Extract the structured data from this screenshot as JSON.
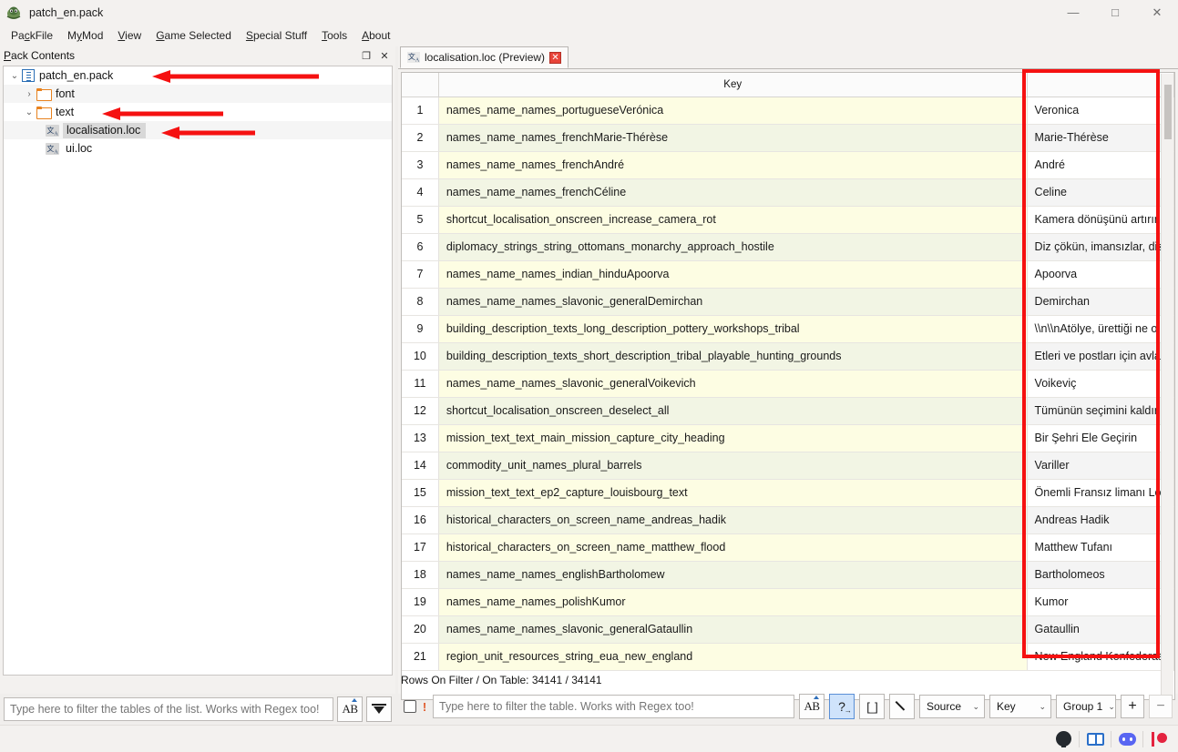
{
  "window": {
    "title": "patch_en.pack",
    "app_icon": "rpfm-app-icon",
    "minimize_label": "—",
    "maximize_label": "□",
    "close_label": "✕"
  },
  "menubar": {
    "items": [
      {
        "label": "PackFile",
        "mnemonic_index": 3
      },
      {
        "label": "MyMod",
        "mnemonic_index": 1
      },
      {
        "label": "View",
        "mnemonic_index": 0
      },
      {
        "label": "Game Selected",
        "mnemonic_index": 0
      },
      {
        "label": "Special Stuff",
        "mnemonic_index": 0
      },
      {
        "label": "Tools",
        "mnemonic_index": 0
      },
      {
        "label": "About",
        "mnemonic_index": 0
      }
    ]
  },
  "left_panel": {
    "header_title": "Pack Contents",
    "float_button": "❐",
    "close_button": "✕",
    "tree": [
      {
        "label": "patch_en.pack",
        "icon": "pack-icon",
        "twisty": "⌄",
        "indent": 0,
        "selected": false
      },
      {
        "label": "font",
        "icon": "folder-icon",
        "twisty": "›",
        "indent": 1,
        "selected": false
      },
      {
        "label": "text",
        "icon": "folder-icon",
        "twisty": "⌄",
        "indent": 1,
        "selected": false
      },
      {
        "label": "localisation.loc",
        "icon": "loc-file-icon",
        "twisty": "",
        "indent": 2,
        "selected": true
      },
      {
        "label": "ui.loc",
        "icon": "loc-file-icon",
        "twisty": "",
        "indent": 2,
        "selected": false
      }
    ],
    "filter": {
      "placeholder": "Type here to filter the tables of the list. Works with Regex too!",
      "value": "",
      "case_button_icon": "case-sensitive-icon",
      "expand_button_icon": "collapse-all-icon"
    }
  },
  "main": {
    "tab": {
      "icon": "loc-file-icon",
      "label": "localisation.loc (Preview)",
      "close_label": "✕"
    },
    "table": {
      "columns": [
        "",
        "Key",
        ""
      ],
      "rows": [
        {
          "n": "1",
          "key": "names_name_names_portugueseVerónica",
          "value": "Veronica"
        },
        {
          "n": "2",
          "key": "names_name_names_frenchMarie-Thérèse",
          "value": "Marie-Thérèse"
        },
        {
          "n": "3",
          "key": "names_name_names_frenchAndré",
          "value": "André"
        },
        {
          "n": "4",
          "key": "names_name_names_frenchCéline",
          "value": "Celine"
        },
        {
          "n": "5",
          "key": "shortcut_localisation_onscreen_increase_camera_rot",
          "value": "Kamera dönüşünü artırın"
        },
        {
          "n": "6",
          "key": "diplomacy_strings_string_ottomans_monarchy_approach_hostile",
          "value": "Diz çökün, imansızlar, diz ç"
        },
        {
          "n": "7",
          "key": "names_name_names_indian_hinduApoorva",
          "value": "Apoorva"
        },
        {
          "n": "8",
          "key": "names_name_names_slavonic_generalDemirchan",
          "value": "Demirchan"
        },
        {
          "n": "9",
          "key": "building_description_texts_long_description_pottery_workshops_tribal",
          "value": "\\\\n\\\\nAtölye, ürettiği ne o"
        },
        {
          "n": "10",
          "key": "building_description_texts_short_description_tribal_playable_hunting_grounds",
          "value": "Etleri ve postları için avlana"
        },
        {
          "n": "11",
          "key": "names_name_names_slavonic_generalVoikevich",
          "value": "Voikeviç"
        },
        {
          "n": "12",
          "key": "shortcut_localisation_onscreen_deselect_all",
          "value": "Tümünün seçimini kaldır"
        },
        {
          "n": "13",
          "key": "mission_text_text_main_mission_capture_city_heading",
          "value": "Bir Şehri Ele Geçirin"
        },
        {
          "n": "14",
          "key": "commodity_unit_names_plural_barrels",
          "value": "Variller"
        },
        {
          "n": "15",
          "key": "mission_text_text_ep2_capture_louisbourg_text",
          "value": "Önemli Fransız limanı Loui"
        },
        {
          "n": "16",
          "key": "historical_characters_on_screen_name_andreas_hadik",
          "value": "Andreas Hadik"
        },
        {
          "n": "17",
          "key": "historical_characters_on_screen_name_matthew_flood",
          "value": "Matthew Tufanı"
        },
        {
          "n": "18",
          "key": "names_name_names_englishBartholomew",
          "value": "Bartholomeos"
        },
        {
          "n": "19",
          "key": "names_name_names_polishKumor",
          "value": "Kumor"
        },
        {
          "n": "20",
          "key": "names_name_names_slavonic_generalGataullin",
          "value": "Gataullin"
        },
        {
          "n": "21",
          "key": "region_unit_resources_string_eua_new_england",
          "value": "New England Konfederasy"
        }
      ]
    },
    "rows_on_filter": "Rows On Filter / On Table: 34141 / 34141",
    "filter_bar": {
      "checkbox_checked": false,
      "bang_label": "!",
      "placeholder": "Type here to filter the table. Works with Regex too!",
      "value": "",
      "case_button_icon": "case-sensitive-icon",
      "regex_button_icon": "regex-icon",
      "group_button_icon": "brackets-icon",
      "edit_button_icon": "pencil-icon",
      "source_select": {
        "value": "Source",
        "caret": "⌄"
      },
      "column_select": {
        "value": "Key",
        "caret": "⌄"
      },
      "group_select": {
        "value": "Group 1",
        "caret": "⌄"
      },
      "add_button": "+",
      "remove_button": "−"
    }
  },
  "statusbar": {
    "icons": [
      {
        "name": "github-icon"
      },
      {
        "name": "manual-book-icon"
      },
      {
        "name": "discord-icon"
      },
      {
        "name": "patreon-icon"
      }
    ]
  },
  "annotations": {
    "highlight_color": "#f51111",
    "arrows": [
      {
        "target": "patch_en.pack tree row"
      },
      {
        "target": "text folder tree row"
      },
      {
        "target": "localisation.loc tree row"
      }
    ],
    "boxes": [
      {
        "target": "translated value column"
      }
    ]
  }
}
